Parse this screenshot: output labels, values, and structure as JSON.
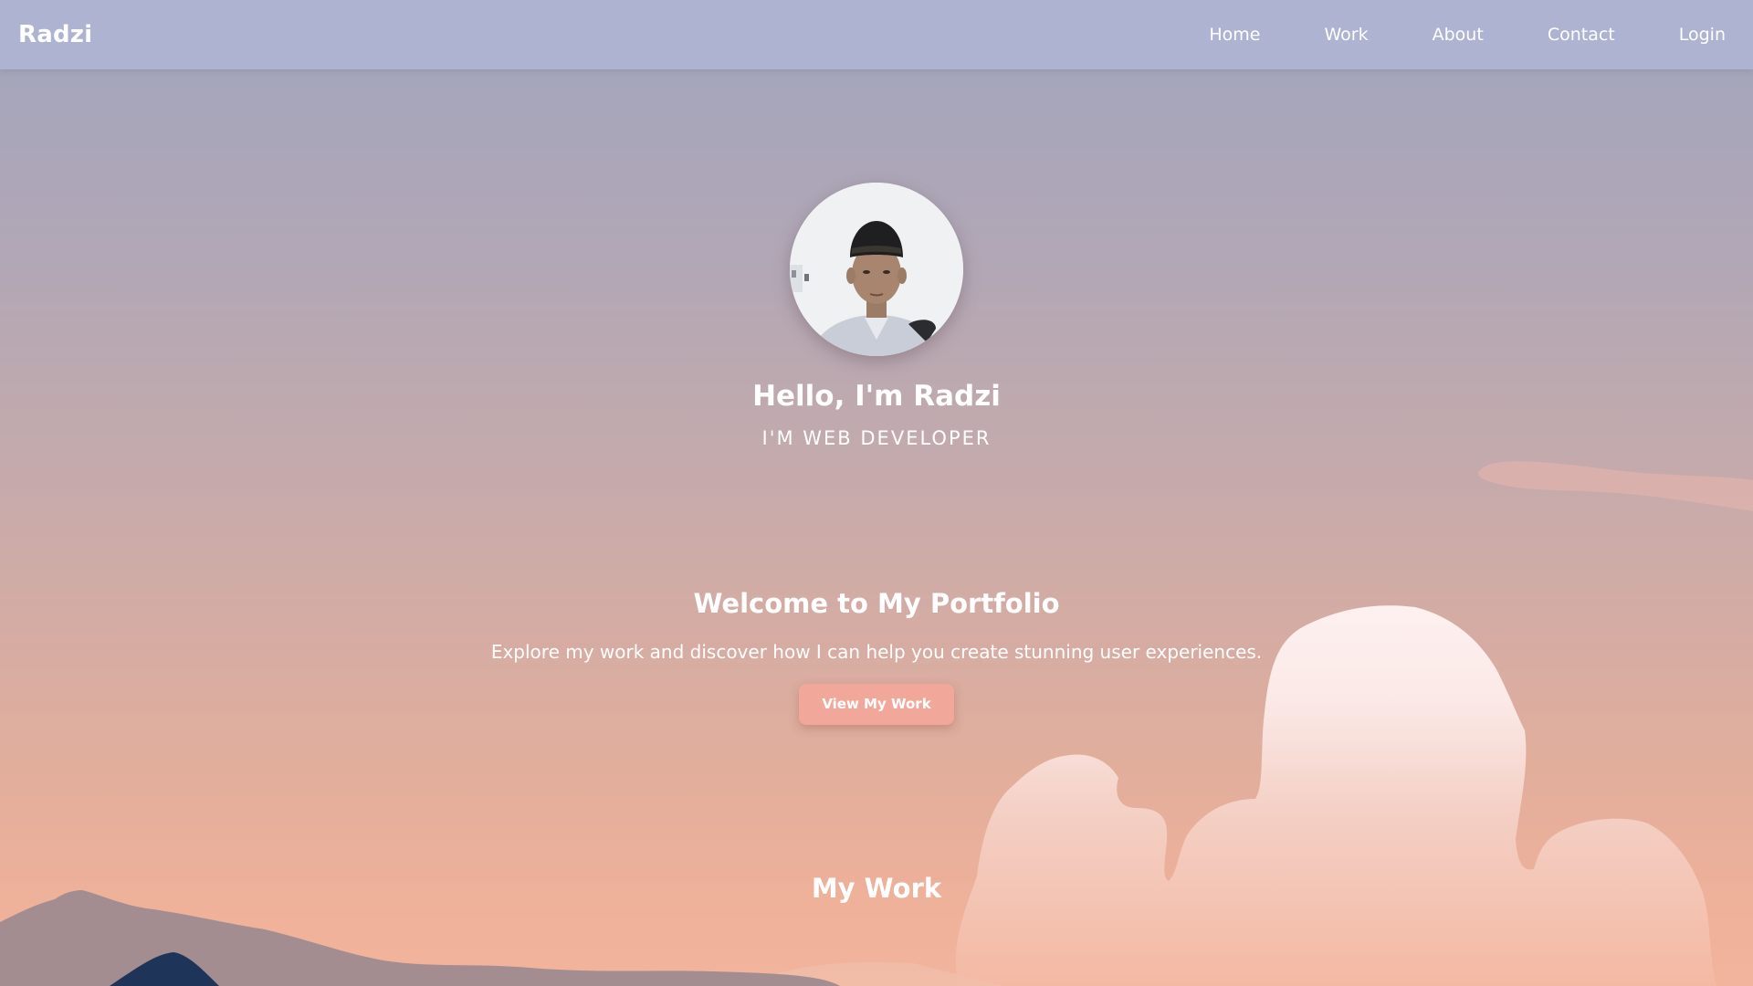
{
  "navbar": {
    "brand": "Radzi",
    "links": [
      {
        "label": "Home"
      },
      {
        "label": "Work"
      },
      {
        "label": "About"
      },
      {
        "label": "Contact"
      },
      {
        "label": "Login"
      }
    ]
  },
  "hero": {
    "name": "Hello, I'm Radzi",
    "role": "I'M WEB DEVELOPER"
  },
  "welcome": {
    "title": "Welcome to My Portfolio",
    "text": "Explore my work and discover how I can help you create stunning user experiences.",
    "button_label": "View My Work"
  },
  "work_section": {
    "title": "My Work"
  },
  "colors": {
    "navbar_bg": "#aeb3d1",
    "button_bg": "#f2a79b",
    "text": "#ffffff"
  }
}
